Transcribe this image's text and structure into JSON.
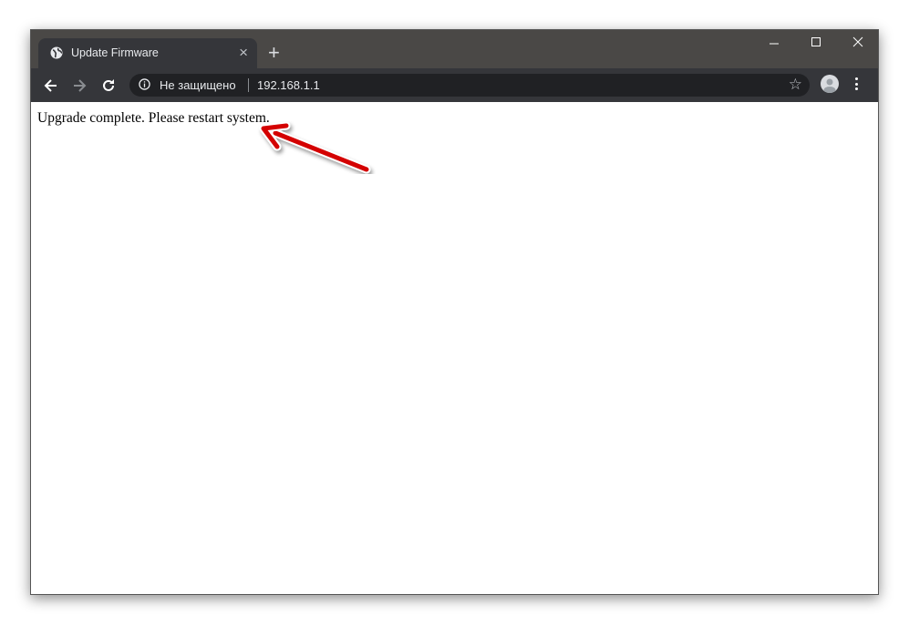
{
  "tab": {
    "title": "Update Firmware",
    "close_icon": "close-icon",
    "favicon": "globe-icon"
  },
  "new_tab": "+",
  "window_controls": {
    "minimize": "—",
    "maximize": "☐",
    "close": "✕"
  },
  "omnibox": {
    "security_label": "Не защищено",
    "url": "192.168.1.1"
  },
  "page": {
    "message": "Upgrade complete. Please restart system."
  },
  "annotation": {
    "arrow_color": "#d40000"
  }
}
